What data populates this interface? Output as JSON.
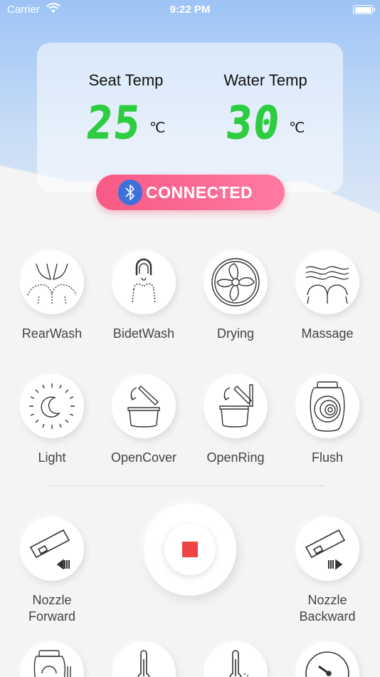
{
  "status_bar": {
    "carrier": "Carrier",
    "time": "9:22 PM"
  },
  "seat_temp": {
    "label": "Seat Temp",
    "value": "25",
    "unit": "℃"
  },
  "water_temp": {
    "label": "Water Temp",
    "value": "30",
    "unit": "℃"
  },
  "connection": {
    "label": "CONNECTED",
    "icon": "bluetooth-icon"
  },
  "functions": [
    {
      "label": "RearWash",
      "icon": "rear-wash-icon"
    },
    {
      "label": "BidetWash",
      "icon": "bidet-wash-icon"
    },
    {
      "label": "Drying",
      "icon": "fan-icon"
    },
    {
      "label": "Massage",
      "icon": "massage-icon"
    },
    {
      "label": "Light",
      "icon": "night-light-icon"
    },
    {
      "label": "OpenCover",
      "icon": "open-cover-icon"
    },
    {
      "label": "OpenRing",
      "icon": "open-ring-icon"
    },
    {
      "label": "Flush",
      "icon": "flush-icon"
    }
  ],
  "nozzle": {
    "forward_label": "Nozzle\nForward",
    "backward_label": "Nozzle\nBackward",
    "stop_icon": "stop-icon"
  },
  "colors": {
    "accent_green": "#2ecc40",
    "connected_pink": "#f75a84",
    "bluetooth_blue": "#3f6fd8",
    "stop_red": "#ef4444"
  }
}
